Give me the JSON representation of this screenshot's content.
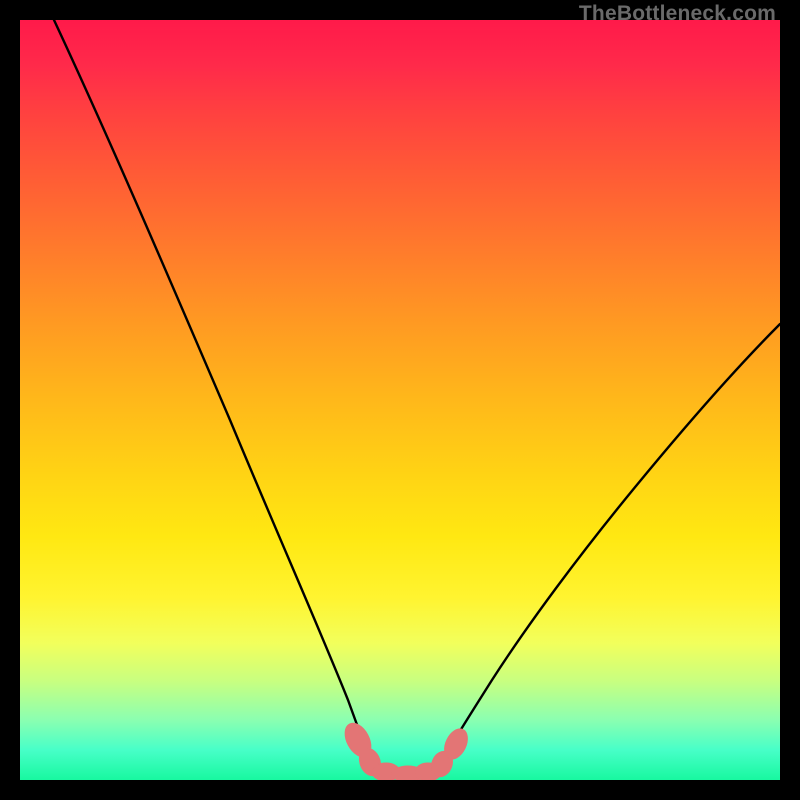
{
  "watermark": "TheBottleneck.com",
  "chart_data": {
    "type": "line",
    "title": "",
    "xlabel": "",
    "ylabel": "",
    "xlim": [
      0,
      100
    ],
    "ylim": [
      0,
      100
    ],
    "grid": false,
    "series": [
      {
        "name": "left-curve",
        "x": [
          4.5,
          10,
          15,
          20,
          25,
          30,
          35,
          40,
          42,
          44,
          46
        ],
        "y": [
          100,
          88,
          76,
          64,
          52,
          40,
          28,
          14,
          8,
          4,
          0.5
        ]
      },
      {
        "name": "right-curve",
        "x": [
          55,
          57,
          60,
          64,
          68,
          74,
          80,
          86,
          92,
          98.5
        ],
        "y": [
          0.5,
          4,
          8,
          14,
          20,
          28,
          36,
          44,
          52,
          60
        ]
      },
      {
        "name": "optimal-band",
        "x": [
          43,
          45,
          47,
          49,
          51,
          53,
          55,
          57
        ],
        "y": [
          3,
          1.5,
          0.6,
          0.3,
          0.3,
          0.6,
          1.5,
          3
        ]
      }
    ],
    "annotations": [
      {
        "text": "TheBottleneck.com",
        "role": "watermark",
        "pos": "top-right"
      }
    ],
    "colors": {
      "gradient_top": "#ff1a4a",
      "gradient_mid": "#ffd414",
      "gradient_bottom": "#18f8a0",
      "curve": "#000000",
      "optimal_marker": "#e37575",
      "frame": "#000000"
    }
  }
}
